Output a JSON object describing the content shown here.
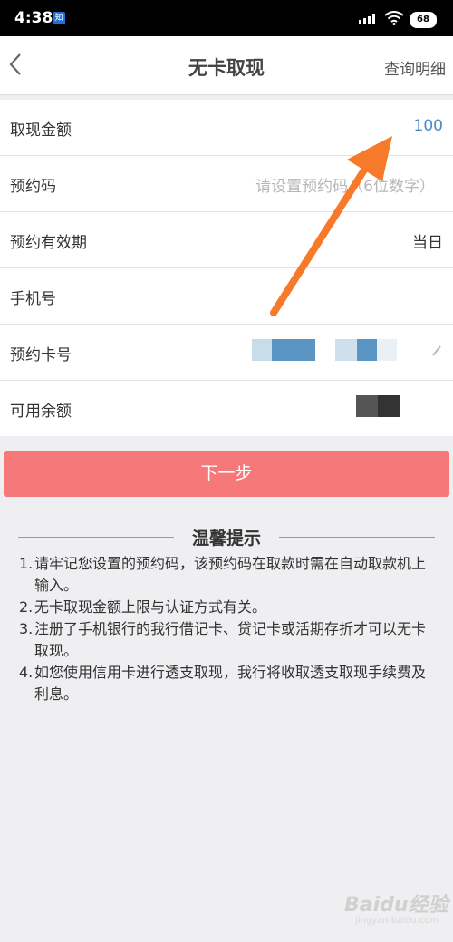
{
  "status_bar": {
    "time": "4:38",
    "app_icon_text": "知",
    "battery": "68"
  },
  "header": {
    "title": "无卡取现",
    "query_link": "查询明细",
    "back_icon": "chevron-left-icon"
  },
  "form": {
    "amount": {
      "label": "取现金额",
      "value": "100"
    },
    "code": {
      "label": "预约码",
      "placeholder": "请设置预约码（6位数字）"
    },
    "validity": {
      "label": "预约有效期",
      "value": "当日"
    },
    "phone": {
      "label": "手机号"
    },
    "card": {
      "label": "预约卡号"
    },
    "balance": {
      "label": "可用余额"
    }
  },
  "next_button": {
    "label": "下一步"
  },
  "tips": {
    "heading": "温馨提示",
    "items": [
      {
        "num": "1.",
        "text": "请牢记您设置的预约码，该预约码在取款时需在自动取款机上输入。"
      },
      {
        "num": "2.",
        "text": "无卡取现金额上限与认证方式有关。"
      },
      {
        "num": "3.",
        "text": "注册了手机银行的我行借记卡、贷记卡或活期存折才可以无卡取现。"
      },
      {
        "num": "4.",
        "text": "如您使用信用卡进行透支取现，我行将收取透支取现手续费及利息。"
      }
    ]
  },
  "watermark": {
    "text": "Baidu经验",
    "sub": "jingyan.baidu.com"
  },
  "colors": {
    "accent_button": "#f77878",
    "input_text": "#4b89c7",
    "arrow": "#f77a2b"
  }
}
